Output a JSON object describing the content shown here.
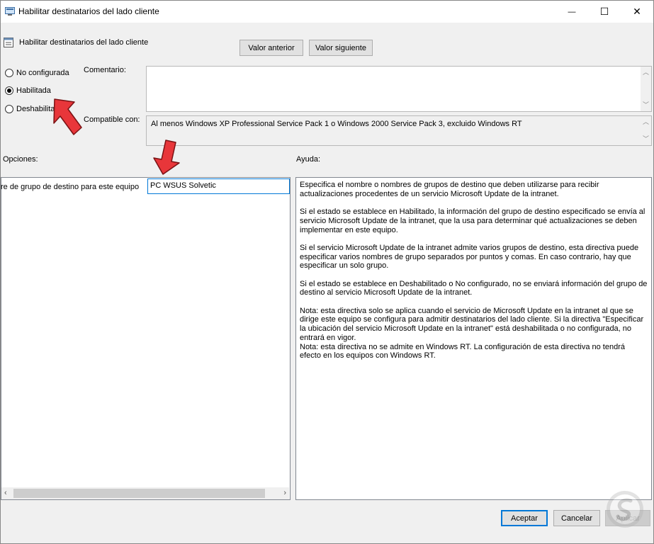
{
  "window": {
    "title": "Habilitar destinatarios del lado cliente",
    "minimize_glyph": "—",
    "maximize_glyph": "☐",
    "close_glyph": "✕"
  },
  "header": {
    "policy_title": "Habilitar destinatarios del lado cliente",
    "prev_button": "Valor anterior",
    "next_button": "Valor siguiente"
  },
  "state": {
    "options": [
      {
        "label": "No configurada",
        "selected": false
      },
      {
        "label": "Habilitada",
        "selected": true
      },
      {
        "label": "Deshabilitada",
        "selected": false
      }
    ]
  },
  "comment": {
    "label": "Comentario:",
    "value": ""
  },
  "compat": {
    "label": "Compatible con:",
    "value": "Al menos Windows XP Professional Service Pack 1 o Windows 2000 Service Pack 3, excluido Windows RT"
  },
  "options_section": {
    "label": "Opciones:",
    "field_label": "re de grupo de destino para este equipo",
    "field_value": "PC WSUS Solvetic"
  },
  "help_section": {
    "label": "Ayuda:",
    "paragraphs": [
      "Especifica el nombre o nombres de grupos de destino que deben utilizarse para recibir actualizaciones procedentes de un servicio Microsoft Update de la intranet.",
      "Si el estado se establece en Habilitado, la información del grupo de destino especificado se envía al servicio Microsoft Update de la intranet, que la usa para determinar qué actualizaciones se deben implementar en este equipo.",
      "Si el servicio Microsoft Update de la intranet admite varios grupos de destino, esta directiva puede especificar varios nombres de grupo separados por puntos y comas. En caso contrario, hay que especificar un solo grupo.",
      "Si el estado se establece en Deshabilitado o No configurado, no se enviará información del grupo de destino al servicio Microsoft Update de la intranet.",
      "Nota: esta directiva solo se aplica cuando el servicio de Microsoft Update en la intranet al que se dirige este equipo se configura para admitir destinatarios del lado cliente. Si la directiva \"Especificar la ubicación del servicio Microsoft Update en la intranet\" está deshabilitada o no configurada, no entrará en vigor.",
      "Nota: esta directiva no se admite en Windows RT. La configuración de esta directiva no tendrá efecto en los equipos con Windows RT."
    ]
  },
  "footer": {
    "accept": "Aceptar",
    "cancel": "Cancelar",
    "apply": "Aplicar"
  },
  "colors": {
    "annotation_arrow": "#e8363a",
    "focus_border": "#0078d7"
  }
}
